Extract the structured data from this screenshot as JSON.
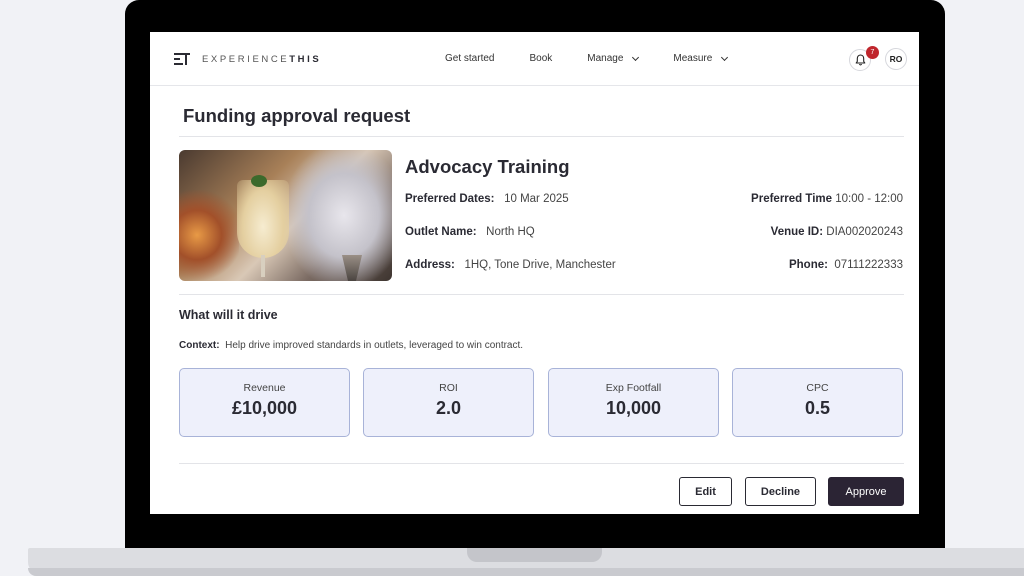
{
  "brand": {
    "prefix": "EXPERIENCE",
    "suffix": "THIS"
  },
  "nav": {
    "items": [
      {
        "label": "Get started"
      },
      {
        "label": "Book"
      },
      {
        "label": "Manage"
      },
      {
        "label": "Measure"
      }
    ],
    "notification_count": "7",
    "avatar_initials": "RO"
  },
  "page": {
    "title": "Funding approval request"
  },
  "event": {
    "title": "Advocacy Training",
    "preferred_dates_label": "Preferred Dates:",
    "preferred_dates": "10 Mar 2025",
    "preferred_time_label": "Preferred Time",
    "preferred_time": "10:00 - 12:00",
    "outlet_name_label": "Outlet Name:",
    "outlet_name": "North HQ",
    "venue_id_label": "Venue ID:",
    "venue_id": "DIA002020243",
    "address_label": "Address:",
    "address": "1HQ, Tone Drive, Manchester",
    "phone_label": "Phone:",
    "phone": "07111222333"
  },
  "drive": {
    "title": "What will it drive",
    "context_label": "Context:",
    "context": "Help drive improved standards in outlets, leveraged to win contract."
  },
  "metrics": [
    {
      "label": "Revenue",
      "value": "£10,000"
    },
    {
      "label": "ROI",
      "value": "2.0"
    },
    {
      "label": "Exp Footfall",
      "value": "10,000"
    },
    {
      "label": "CPC",
      "value": "0.5"
    }
  ],
  "actions": {
    "edit": "Edit",
    "decline": "Decline",
    "approve": "Approve"
  },
  "colors": {
    "accent_dark": "#2b2434",
    "metric_bg": "#eef0fb",
    "metric_border": "#a8b3d8",
    "badge": "#c0262d"
  },
  "icons": [
    "brand-logo-icon",
    "chevron-down-icon",
    "bell-icon"
  ]
}
